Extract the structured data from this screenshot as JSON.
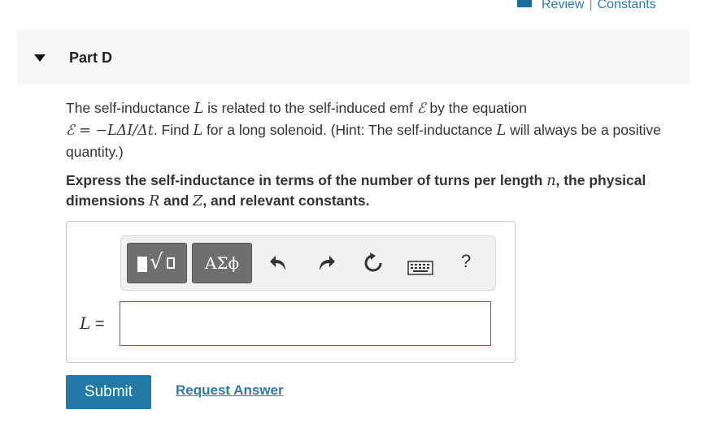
{
  "header_links": {
    "review": "Review",
    "separator": "|",
    "constants": "Constants"
  },
  "part": {
    "title": "Part D"
  },
  "question": {
    "t1": "The self-inductance ",
    "L": "L",
    "t2": " is related to the self-induced emf ",
    "emf": "ℰ",
    "t3": " by the equation",
    "eq_left": "ℰ",
    "eq_mid": " = −",
    "eq_right": "LΔI/Δt",
    "t4": ". Find ",
    "t5": " for a long solenoid. (Hint: The self-inductance ",
    "t6": " will always be a positive quantity.)"
  },
  "instruction": {
    "t1": "Express the self-inductance in terms of the number of turns per length ",
    "n": "n",
    "t2": ", the physical dimensions ",
    "R": "R",
    "t3": " and ",
    "Z": "Z",
    "t4": ", and relevant constants."
  },
  "toolbar": {
    "symbols_label": "ΑΣϕ",
    "help": "?"
  },
  "answer": {
    "label_var": "L",
    "label_eq": " =",
    "value": ""
  },
  "buttons": {
    "submit": "Submit",
    "request": "Request Answer"
  },
  "colors": {
    "accent": "#237aa6",
    "link": "#2a7ab0",
    "toolbar_btn": "#6f6f6f"
  },
  "icons": [
    "templates-icon",
    "undo-icon",
    "redo-icon",
    "reset-icon",
    "keyboard-icon",
    "help-icon"
  ]
}
